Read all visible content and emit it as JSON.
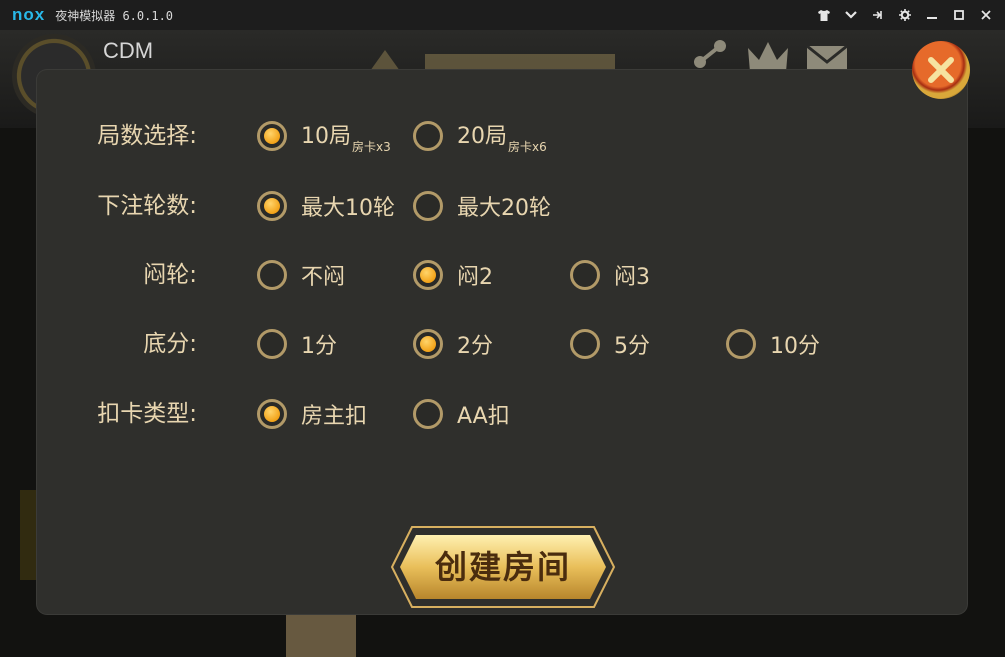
{
  "window": {
    "logo": "nox",
    "title": "夜神模拟器 6.0.1.0",
    "buttons": [
      "shirt-icon",
      "chevron-down-icon",
      "pin-icon",
      "gear-icon",
      "minimize-icon",
      "maximize-icon",
      "close-icon"
    ]
  },
  "game": {
    "username": "CDM"
  },
  "dialog": {
    "rows": [
      {
        "label": "局数选择:",
        "options": [
          {
            "text": "10局",
            "sub": "房卡x3",
            "selected": true
          },
          {
            "text": "20局",
            "sub": "房卡x6",
            "selected": false
          }
        ]
      },
      {
        "label": "下注轮数:",
        "options": [
          {
            "text": "最大10轮",
            "selected": true
          },
          {
            "text": "最大20轮",
            "selected": false
          }
        ]
      },
      {
        "label": "闷轮:",
        "options": [
          {
            "text": "不闷",
            "selected": false
          },
          {
            "text": "闷2",
            "selected": true
          },
          {
            "text": "闷3",
            "selected": false
          }
        ]
      },
      {
        "label": "底分:",
        "options": [
          {
            "text": "1分",
            "selected": false
          },
          {
            "text": "2分",
            "selected": true
          },
          {
            "text": "5分",
            "selected": false
          },
          {
            "text": "10分",
            "selected": false
          }
        ]
      },
      {
        "label": "扣卡类型:",
        "options": [
          {
            "text": "房主扣",
            "selected": true
          },
          {
            "text": "AA扣",
            "selected": false
          }
        ]
      }
    ],
    "create_button": "创建房间"
  },
  "colors": {
    "accent": "#f2a218",
    "label": "#e8d6b0",
    "dialog_bg": "#2f2f2c"
  }
}
